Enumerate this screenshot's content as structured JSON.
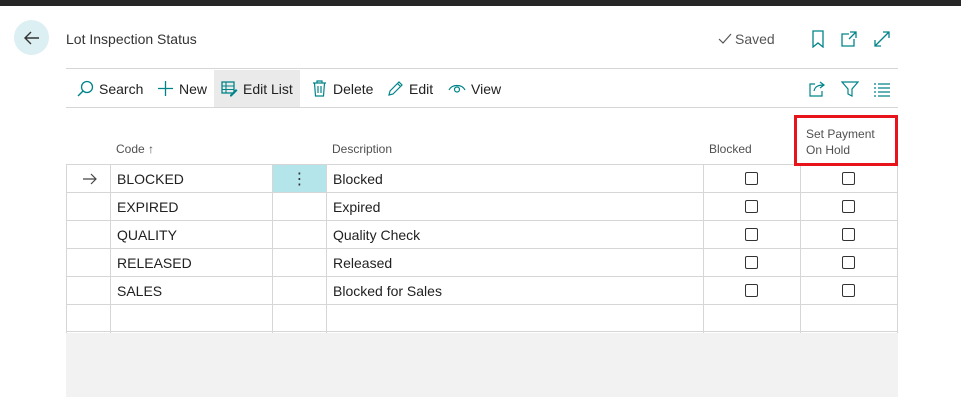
{
  "header": {
    "title": "Lot Inspection Status",
    "saved_label": "Saved"
  },
  "toolbar": {
    "search": "Search",
    "new": "New",
    "edit_list": "Edit List",
    "delete": "Delete",
    "edit": "Edit",
    "view": "View"
  },
  "columns": {
    "code": "Code",
    "code_sort": "↑",
    "description": "Description",
    "blocked": "Blocked",
    "set_payment_line1": "Set Payment",
    "set_payment_line2": "On Hold"
  },
  "rows": [
    {
      "code": "BLOCKED",
      "description": "Blocked",
      "blocked": false,
      "set_payment_on_hold": false,
      "selected": true
    },
    {
      "code": "EXPIRED",
      "description": "Expired",
      "blocked": false,
      "set_payment_on_hold": false
    },
    {
      "code": "QUALITY",
      "description": "Quality Check",
      "blocked": false,
      "set_payment_on_hold": false
    },
    {
      "code": "RELEASED",
      "description": "Released",
      "blocked": false,
      "set_payment_on_hold": false
    },
    {
      "code": "SALES",
      "description": "Blocked for Sales",
      "blocked": false,
      "set_payment_on_hold": false
    }
  ],
  "icons": {
    "back": "back-arrow-icon",
    "saved": "checkmark-icon",
    "bookmark": "bookmark-icon",
    "open_new": "open-in-new-window-icon",
    "expand": "expand-icon",
    "search": "search-icon",
    "new": "plus-icon",
    "edit_list": "edit-list-icon",
    "delete": "trash-icon",
    "edit": "pencil-icon",
    "view": "eye-icon",
    "share": "share-icon",
    "filter": "filter-icon",
    "list": "list-view-icon"
  },
  "colors": {
    "accent": "#008489",
    "selected_cell": "#b3e5ea",
    "highlight": "#e8141c"
  }
}
